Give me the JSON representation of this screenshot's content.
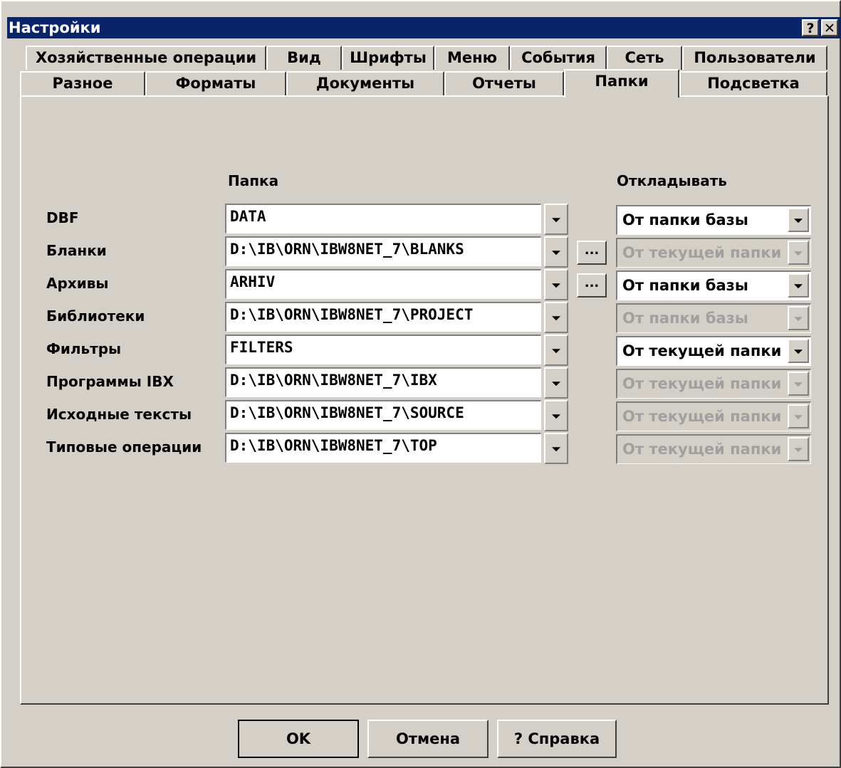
{
  "window": {
    "title": "Настройки",
    "help_btn": "?",
    "close_btn": "✕"
  },
  "tabs_row1": [
    {
      "label": "Хозяйственные операции"
    },
    {
      "label": "Вид"
    },
    {
      "label": "Шрифты"
    },
    {
      "label": "Меню"
    },
    {
      "label": "События"
    },
    {
      "label": "Сеть"
    },
    {
      "label": "Пользователи"
    }
  ],
  "tabs_row2": [
    {
      "label": "Разное"
    },
    {
      "label": "Форматы"
    },
    {
      "label": "Документы"
    },
    {
      "label": "Отчеты"
    },
    {
      "label": "Папки",
      "active": true
    },
    {
      "label": "Подсветка"
    }
  ],
  "headers": {
    "folder": "Папка",
    "postpone": "Откладывать"
  },
  "rows": [
    {
      "label": "DBF",
      "path": "DATA",
      "has_browse": false,
      "postpone": "От папки базы",
      "postpone_enabled": true
    },
    {
      "label": "Бланки",
      "path": "D:\\IB\\ORN\\IBW8NET_7\\BLANKS",
      "has_browse": true,
      "browse_label": "...",
      "postpone": "От текущей папки",
      "postpone_enabled": false
    },
    {
      "label": "Архивы",
      "path": "ARHIV",
      "has_browse": true,
      "browse_label": "...",
      "postpone": "От папки базы",
      "postpone_enabled": true
    },
    {
      "label": "Библиотеки",
      "path": "D:\\IB\\ORN\\IBW8NET_7\\PROJECT",
      "has_browse": false,
      "postpone": "От папки базы",
      "postpone_enabled": false
    },
    {
      "label": "Фильтры",
      "path": "FILTERS",
      "has_browse": false,
      "postpone": "От текущей папки",
      "postpone_enabled": true
    },
    {
      "label": "Программы IBX",
      "path": "D:\\IB\\ORN\\IBW8NET_7\\IBX",
      "has_browse": false,
      "postpone": "От текущей папки",
      "postpone_enabled": false
    },
    {
      "label": "Исходные тексты",
      "path": "D:\\IB\\ORN\\IBW8NET_7\\SOURCE",
      "has_browse": false,
      "postpone": "От текущей папки",
      "postpone_enabled": false
    },
    {
      "label": "Типовые операции",
      "path": "D:\\IB\\ORN\\IBW8NET_7\\TOP",
      "has_browse": false,
      "postpone": "От текущей папки",
      "postpone_enabled": false
    }
  ],
  "buttons": {
    "ok": "OK",
    "cancel": "Отмена",
    "help": "? Справка"
  }
}
